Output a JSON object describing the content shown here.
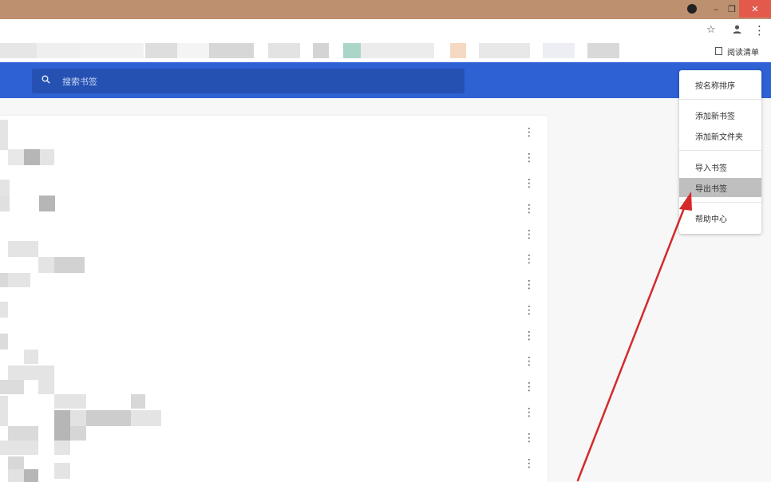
{
  "window": {
    "minimize_glyph": "–",
    "restore_glyph": "❐",
    "close_glyph": "✕"
  },
  "toolbar": {
    "bookmark_icon": "star-icon",
    "profile_icon": "profile-icon",
    "menu_glyph": "⋮"
  },
  "bookmarks_bar": {
    "reading_list_label": "阅读清单"
  },
  "search": {
    "placeholder": "搜索书签"
  },
  "list": {
    "row_action_glyph": "⋮"
  },
  "menu": {
    "items": [
      {
        "label": "按名称排序"
      },
      {
        "label": "添加新书签"
      },
      {
        "label": "添加新文件夹"
      },
      {
        "label": "导入书签"
      },
      {
        "label": "导出书签",
        "highlighted": true
      },
      {
        "label": "帮助中心"
      }
    ]
  },
  "colors": {
    "titlebar": "#bd9070",
    "header_blue": "#2e61d3",
    "search_blue": "#2551b3",
    "annotation_arrow": "#d42a2a",
    "menu_highlight": "#bfbfbf"
  }
}
